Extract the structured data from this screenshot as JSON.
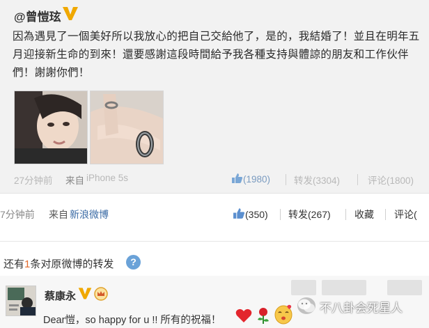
{
  "original_post": {
    "author": "@曾愷玹",
    "text": "因為遇見了一個美好所以我放心的把自己交給他了，是的，我結婚了！並且在明年五月迎接新生命的到來！還要感謝這段時間給予我各種支持與體諒的朋友和工作伙伴們！謝謝你們！",
    "time": "27分钟前",
    "source_prefix": "来自",
    "source_name": "iPhone 5s",
    "likes": "(1980)",
    "reposts": "转发(3304)",
    "comments": "评论(1800)"
  },
  "repost": {
    "time": "7分钟前",
    "source_prefix": "来自",
    "source_name": "新浪微博",
    "likes": "(350)",
    "reposts": "转发(267)",
    "favorite": "收藏",
    "comments": "评论("
  },
  "repost_list": {
    "prefix": "还有",
    "count": "1",
    "suffix": "条对原微博的转发",
    "help": "?"
  },
  "comment": {
    "name": "蔡康永",
    "text": "Dear愷，so happy for u !! 所有的祝福！"
  },
  "watermark": {
    "text": "不八卦会死星人"
  },
  "colors": {
    "link_blue": "#3b6ba5",
    "highlight_orange": "#e26a2c",
    "verified_gold": "#f0a800"
  },
  "icons": [
    "verified-v-icon",
    "thumb-up-icon",
    "help-icon",
    "crown-icon",
    "heart-icon",
    "rose-icon",
    "kiss-face-icon",
    "wechat-icon"
  ]
}
